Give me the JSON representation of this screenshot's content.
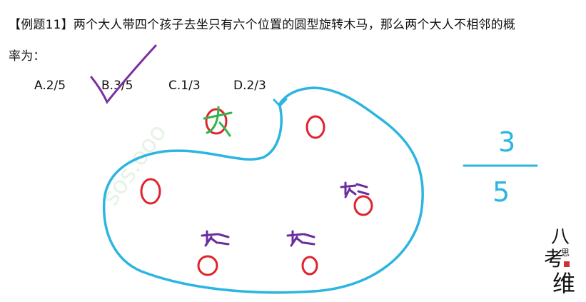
{
  "question": {
    "line1": "【例题11】两个大人带四个孩子去坐只有六个位置的圆型旋转木马，那么两个大人不相邻的概",
    "line2": "率为："
  },
  "options": [
    {
      "label": "A.2/5"
    },
    {
      "label": "B.3/5"
    },
    {
      "label": "C.1/3"
    },
    {
      "label": "D.2/3"
    }
  ],
  "annotations": {
    "adult_mark": "大",
    "answer_numerator": "3",
    "answer_denominator": "5"
  },
  "watermark": "sos.ooo",
  "logo_text": "八公考思维",
  "colors": {
    "circle": "#2bb5e0",
    "seat": "#e0232e",
    "adult": "#6a2d9e",
    "check": "#7b2fa0",
    "cross": "#2fb54a"
  }
}
